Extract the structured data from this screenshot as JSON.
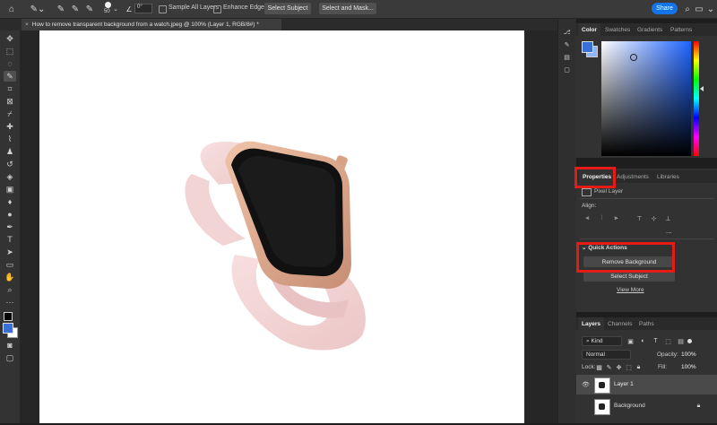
{
  "options_bar": {
    "brush_size": "50",
    "angle": "0°",
    "sample_all_layers": "Sample All Layers",
    "enhance_edge": "Enhance Edge",
    "select_subject": "Select Subject",
    "select_and_mask": "Select and Mask...",
    "share": "Share"
  },
  "document_tab": {
    "title": "How to remove transparent background from a watch.jpeg @ 100% (Layer 1, RGB/8#) *"
  },
  "color_panel": {
    "tabs": [
      "Color",
      "Swatches",
      "Gradients",
      "Patterns"
    ],
    "active_tab": "Color",
    "hue_color": "#1e63ff"
  },
  "properties_panel": {
    "tabs": [
      "Properties",
      "Adjustments",
      "Libraries"
    ],
    "active_tab": "Properties",
    "layer_kind": "Pixel Layer",
    "align_label": "Align:",
    "more": "...",
    "quick_actions_label": "Quick Actions",
    "remove_background": "Remove Background",
    "select_subject": "Select Subject",
    "view_more": "View More"
  },
  "layers_panel": {
    "tabs": [
      "Layers",
      "Channels",
      "Paths"
    ],
    "active_tab": "Layers",
    "filter_kind": "Kind",
    "blend_mode": "Normal",
    "opacity_label": "Opacity:",
    "opacity": "100%",
    "lock_label": "Lock:",
    "fill_label": "Fill:",
    "fill": "100%",
    "layers": [
      {
        "name": "Layer 1",
        "selected": true
      },
      {
        "name": "Background",
        "selected": false
      }
    ]
  },
  "colors": {
    "highlight": "#e41b17",
    "accent": "#1473e6",
    "watch_band": "#f2d3d3"
  }
}
